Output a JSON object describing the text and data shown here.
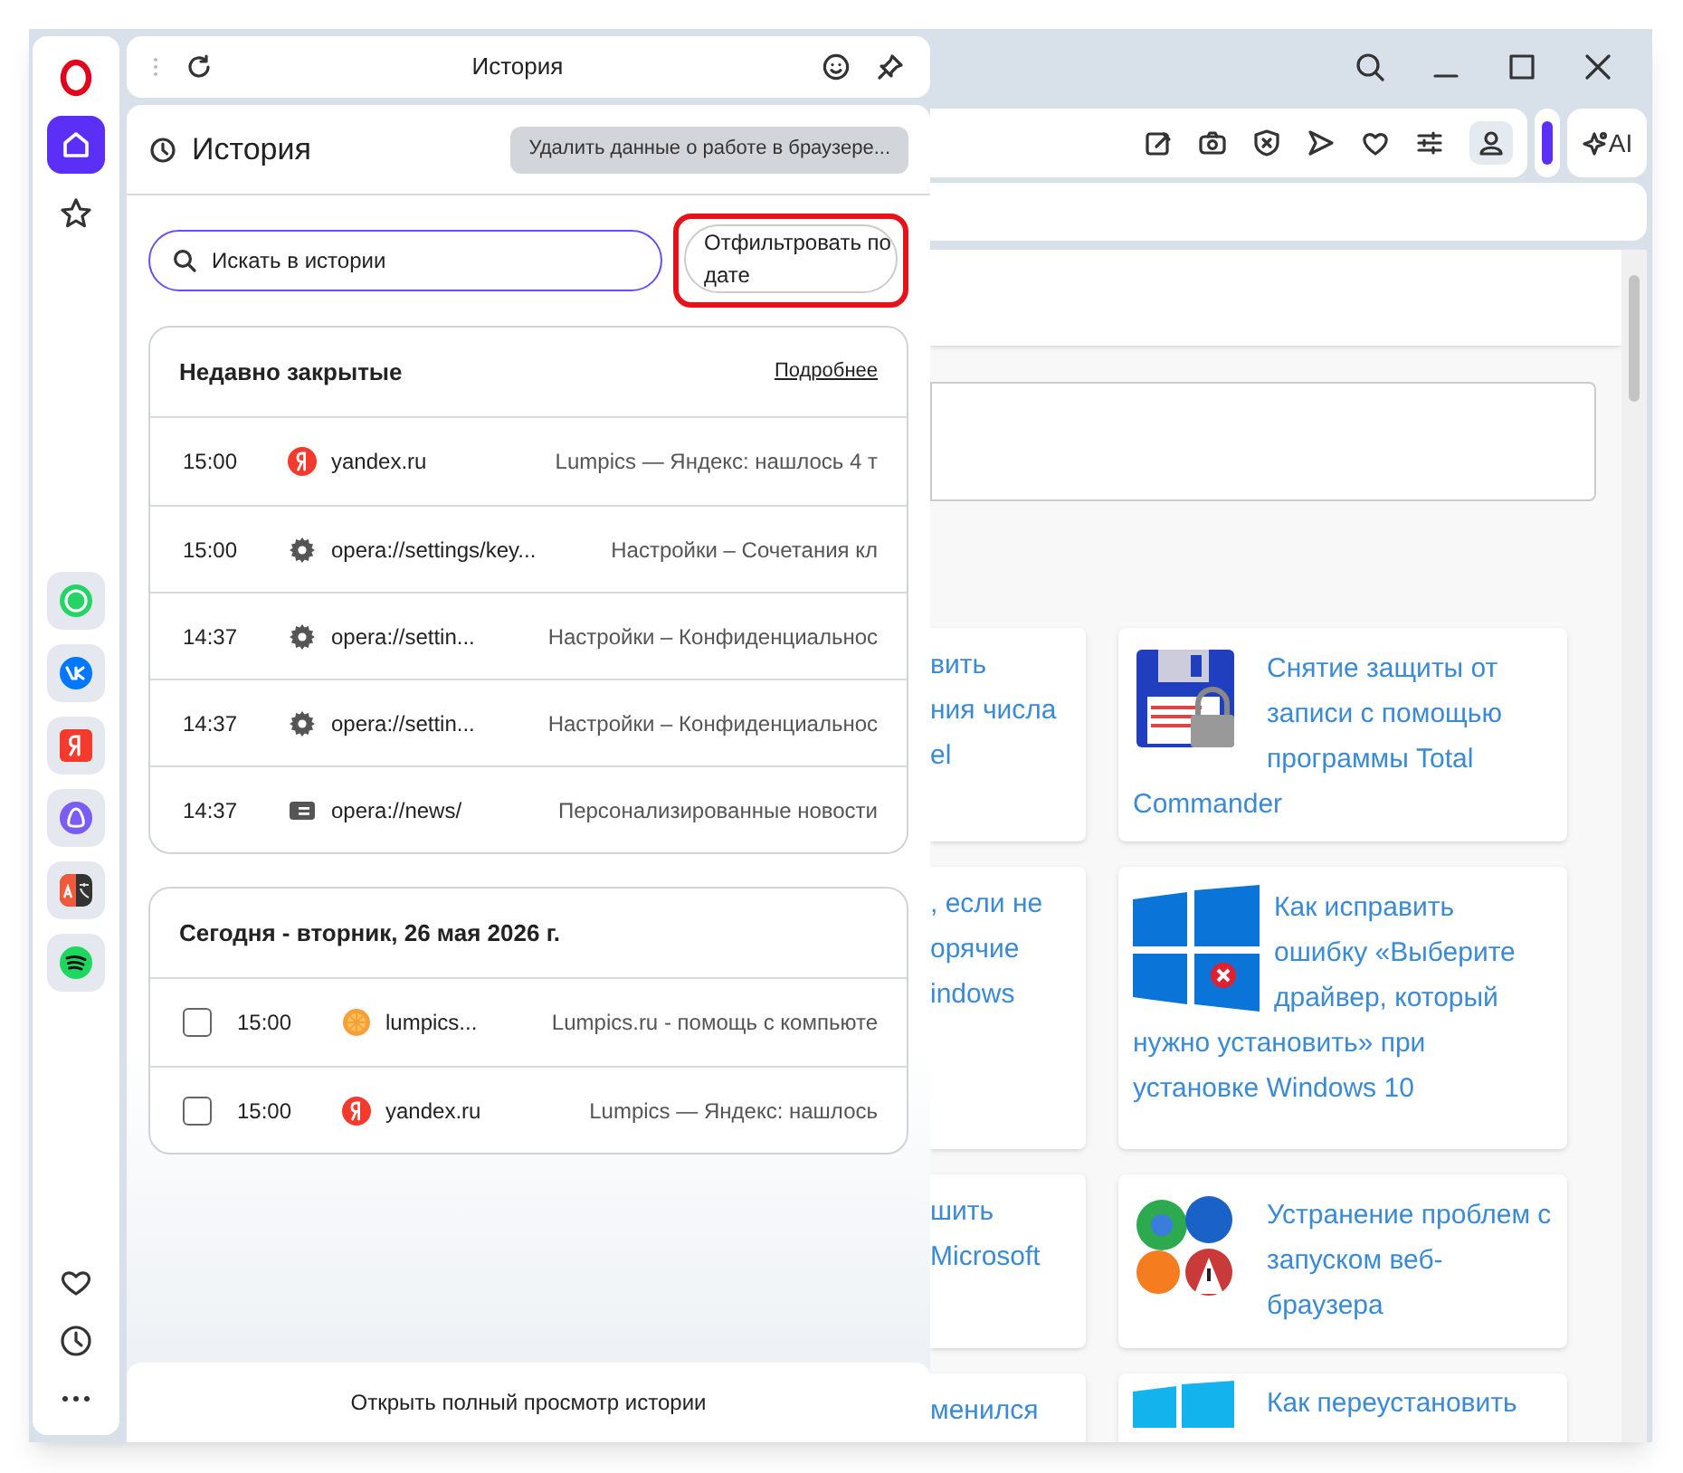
{
  "sidebar": {
    "nav": [
      {
        "kind": "home",
        "selected": true
      },
      {
        "kind": "star",
        "selected": false
      }
    ],
    "apps": [
      {
        "kind": "whatsapp",
        "color": "#25d366"
      },
      {
        "kind": "vk",
        "color": "#0077ff"
      },
      {
        "kind": "yandex",
        "color": "#f33a2c"
      },
      {
        "kind": "alice",
        "color": "#7b5cf5"
      },
      {
        "kind": "translate",
        "color": "#f05a3c"
      },
      {
        "kind": "spotify",
        "color": "#1ed760"
      }
    ],
    "bottom": [
      {
        "kind": "heart"
      },
      {
        "kind": "clock"
      },
      {
        "kind": "dots"
      }
    ]
  },
  "history_panel": {
    "title": "История",
    "heading": "История",
    "clear_button": "Удалить данные о работе в браузере...",
    "search": {
      "placeholder": "Искать в истории"
    },
    "filter_button": {
      "label": "Отфильтровать по дате",
      "highlighted": true
    },
    "recently_closed": {
      "title": "Недавно закрытые",
      "more_link": "Подробнее",
      "rows": [
        {
          "time": "15:00",
          "kind": "yandex",
          "url": "yandex.ru",
          "page_title": "Lumpics — Яндекс: нашлось 4 т"
        },
        {
          "time": "15:00",
          "kind": "gear",
          "url": "opera://settings/key...",
          "page_title": "Настройки – Сочетания кл"
        },
        {
          "time": "14:37",
          "kind": "gear",
          "url": "opera://settin...",
          "page_title": "Настройки – Конфиденциальнос"
        },
        {
          "time": "14:37",
          "kind": "gear",
          "url": "opera://settin...",
          "page_title": "Настройки – Конфиденциальнос"
        },
        {
          "time": "14:37",
          "kind": "news",
          "url": "opera://news/",
          "page_title": "Персонализированные новости"
        }
      ]
    },
    "today": {
      "title": "Сегодня - вторник, 26 мая 2026 г.",
      "rows": [
        {
          "checked": false,
          "time": "15:00",
          "kind": "orange",
          "url": "lumpics...",
          "page_title": "Lumpics.ru - помощь с компьюте"
        },
        {
          "checked": false,
          "time": "15:00",
          "kind": "yandex",
          "url": "yandex.ru",
          "page_title": "Lumpics — Яндекс: нашлось"
        }
      ]
    },
    "open_full_button": "Открыть полный просмотр истории"
  },
  "browser": {
    "ai_button": "AI",
    "left_cards": [
      {
        "lines": [
          "вить",
          "ния числа",
          "el"
        ]
      },
      {
        "lines": [
          ", если не",
          "орячие",
          "indows"
        ]
      },
      {
        "lines": [
          "шить",
          "Microsoft"
        ]
      },
      {
        "lines": [
          "менился"
        ]
      }
    ],
    "right_cards": [
      {
        "kind": "floppy",
        "title": "Снятие защиты от записи с помощью программы Total Commander"
      },
      {
        "kind": "windows-error",
        "title": "Как исправить ошибку «Выберите драйвер, который нужно установить» при установке Windows 10"
      },
      {
        "kind": "browsers",
        "title": "Устранение проблем с запуском веб-браузера"
      },
      {
        "kind": "windows",
        "title": "Как переустановить"
      }
    ]
  }
}
